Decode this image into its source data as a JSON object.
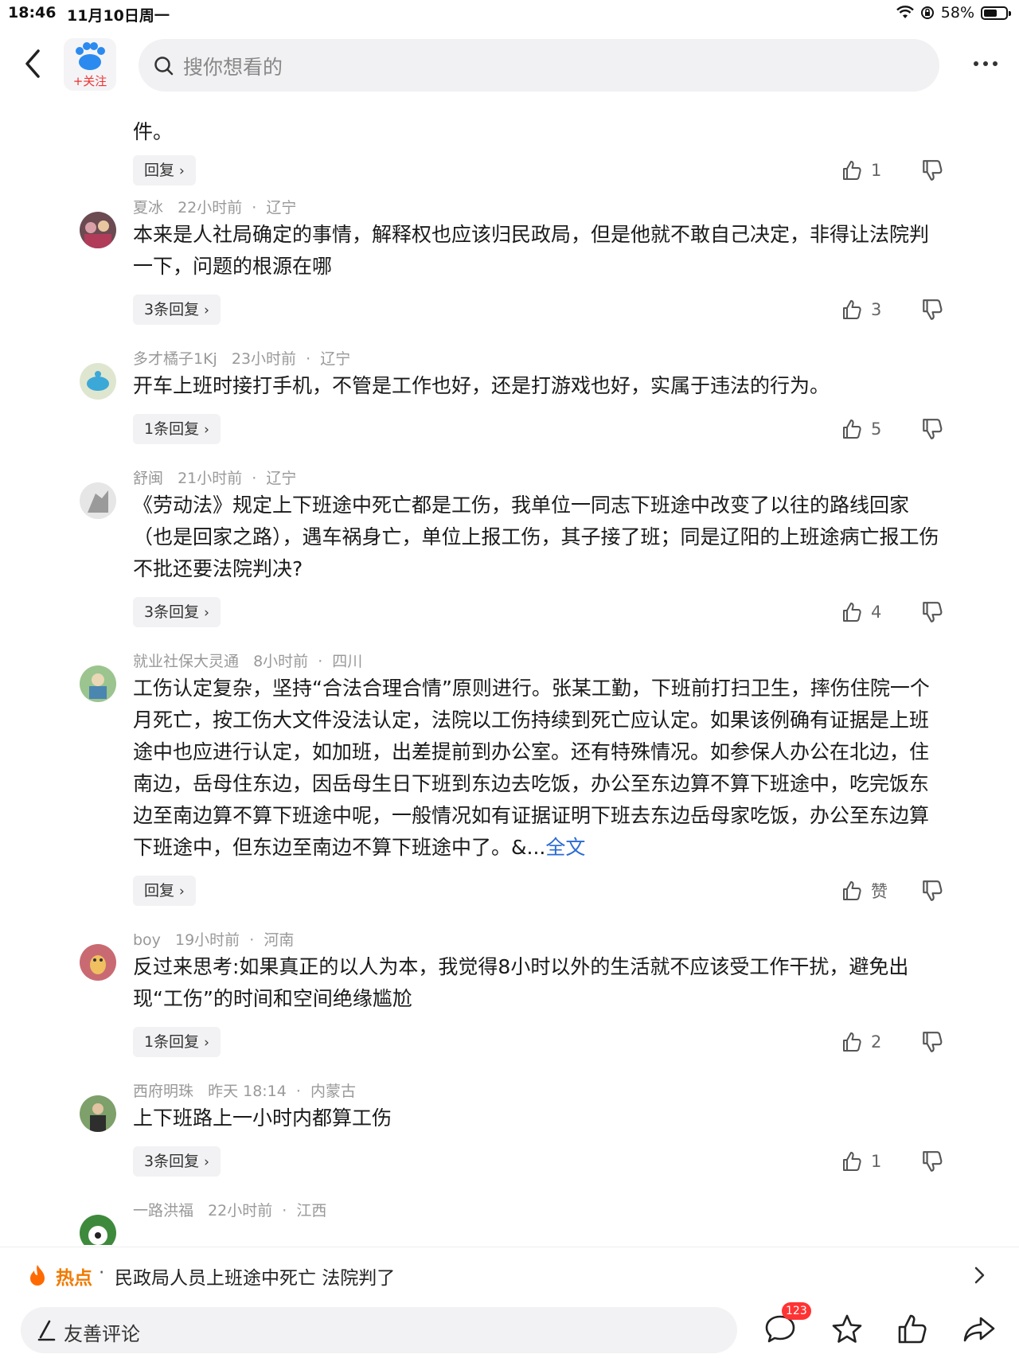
{
  "status_bar": {
    "time": "18:46",
    "date": "11月10日周一",
    "battery_percent": "58%"
  },
  "nav": {
    "follow_label": "+关注",
    "search_placeholder": "搜你想看的"
  },
  "comments": [
    {
      "partial_text": "件。",
      "reply_label": "回复",
      "likes": "1"
    },
    {
      "author": "夏冰",
      "time": "22小时前",
      "location": "辽宁",
      "text": "本来是人社局确定的事情，解释权也应该归民政局，但是他就不敢自己决定，非得让法院判一下，问题的根源在哪",
      "reply_label": "3条回复",
      "likes": "3"
    },
    {
      "author": "多才橘子1Kj",
      "time": "23小时前",
      "location": "辽宁",
      "text": "开车上班时接打手机，不管是工作也好，还是打游戏也好，实属于违法的行为。",
      "reply_label": "1条回复",
      "likes": "5"
    },
    {
      "author": "舒闽",
      "time": "21小时前",
      "location": "辽宁",
      "text": "《劳动法》规定上下班途中死亡都是工伤，我单位一同志下班途中改变了以往的路线回家（也是回家之路），遇车祸身亡，单位上报工伤，其子接了班；同是辽阳的上班途病亡报工伤不批还要法院判决?",
      "reply_label": "3条回复",
      "likes": "4"
    },
    {
      "author": "就业社保大灵通",
      "time": "8小时前",
      "location": "四川",
      "text": "工伤认定复杂，坚持“合法合理合情”原则进行。张某工勤，下班前打扫卫生，摔伤住院一个月死亡，按工伤大文件没法认定，法院以工伤持续到死亡应认定。如果该例确有证据是上班途中也应进行认定，如加班，出差提前到办公室。还有特殊情况。如参保人办公在北边，住南边，岳母住东边，因岳母生日下班到东边去吃饭，办公至东边算不算下班途中，吃完饭东边至南边算不算下班途中呢，一般情况如有证据证明下班去东边岳母家吃饭，办公至东边算下班途中，但东边至南边不算下班途中了。&...",
      "more_link": "全文",
      "reply_label": "回复",
      "likes": "赞"
    },
    {
      "author": "boy",
      "time": "19小时前",
      "location": "河南",
      "text": "反过来思考:如果真正的以人为本，我觉得8小时以外的生活就不应该受工作干扰，避免出现“工伤”的时间和空间绝缘尴尬",
      "reply_label": "1条回复",
      "likes": "2"
    },
    {
      "author": "西府明珠",
      "time": "昨天 18:14",
      "location": "内蒙古",
      "text": "上下班路上一小时内都算工伤",
      "reply_label": "3条回复",
      "likes": "1"
    },
    {
      "author": "一路洪福",
      "time": "22小时前",
      "location": "江西"
    }
  ],
  "hot_bar": {
    "label": "热点",
    "separator": "·",
    "title": "民政局人员上班途中死亡 法院判了"
  },
  "bottom_bar": {
    "comment_placeholder": "友善评论",
    "comment_count_badge": "123"
  }
}
